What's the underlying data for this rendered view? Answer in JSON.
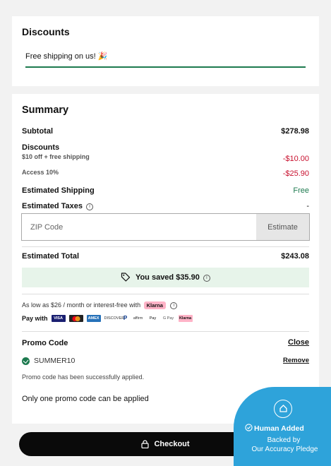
{
  "discounts": {
    "title": "Discounts",
    "free_shipping": "Free shipping on us! 🎉"
  },
  "summary": {
    "title": "Summary",
    "subtotal_label": "Subtotal",
    "subtotal_value": "$278.98",
    "discounts_label": "Discounts",
    "discount1_label": "$10 off + free shipping",
    "discount1_value": "-$10.00",
    "discount2_label": "Access 10%",
    "discount2_value": "-$25.90",
    "shipping_label": "Estimated Shipping",
    "shipping_value": "Free",
    "taxes_label": "Estimated Taxes",
    "taxes_value": "-",
    "zip_placeholder": "ZIP Code",
    "estimate_label": "Estimate",
    "total_label": "Estimated Total",
    "total_value": "$243.08",
    "saved_text": "You saved $35.90",
    "as_low_as": "As low as $26 / month or interest-free with",
    "klarna": "Klarna",
    "pay_with": "Pay with",
    "payment_methods": [
      "VISA",
      "Mastercard",
      "AMEX",
      "Discover",
      "PayPal",
      "Affirm",
      "Apple Pay",
      "Google Pay",
      "Klarna"
    ],
    "promo_label": "Promo Code",
    "promo_close": "Close",
    "promo_code": "SUMMER10",
    "promo_remove": "Remove",
    "promo_success": "Promo code has been successfully applied.",
    "only_one": "Only one promo code can be applied"
  },
  "checkout_label": "Checkout",
  "badge": {
    "human_added": "Human Added",
    "backed_by": "Backed by",
    "pledge": "Our Accuracy Pledge"
  },
  "colors": {
    "accent_green": "#1d7a4f",
    "discount_red": "#c8102e",
    "badge_blue": "#2ea3da",
    "saved_bg": "#e7f4ea"
  }
}
